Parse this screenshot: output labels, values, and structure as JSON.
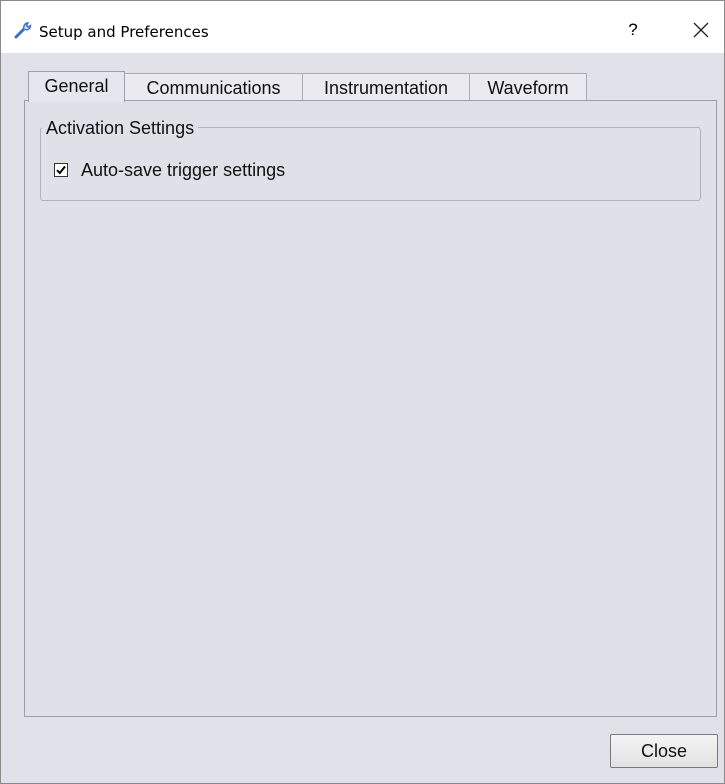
{
  "window": {
    "title": "Setup and Preferences",
    "help_label": "?"
  },
  "tabs": [
    {
      "label": "General",
      "active": true
    },
    {
      "label": "Communications",
      "active": false
    },
    {
      "label": "Instrumentation",
      "active": false
    },
    {
      "label": "Waveform",
      "active": false
    }
  ],
  "general": {
    "group_title": "Activation Settings",
    "autosave": {
      "label": "Auto-save trigger settings",
      "checked": true
    }
  },
  "footer": {
    "close_label": "Close"
  },
  "colors": {
    "background": "#e1e1ea",
    "titlebar": "#ffffff",
    "icon_accent": "#3a6fc4"
  },
  "icons": [
    "wrench-icon",
    "help-icon",
    "close-icon",
    "checkmark-icon"
  ]
}
